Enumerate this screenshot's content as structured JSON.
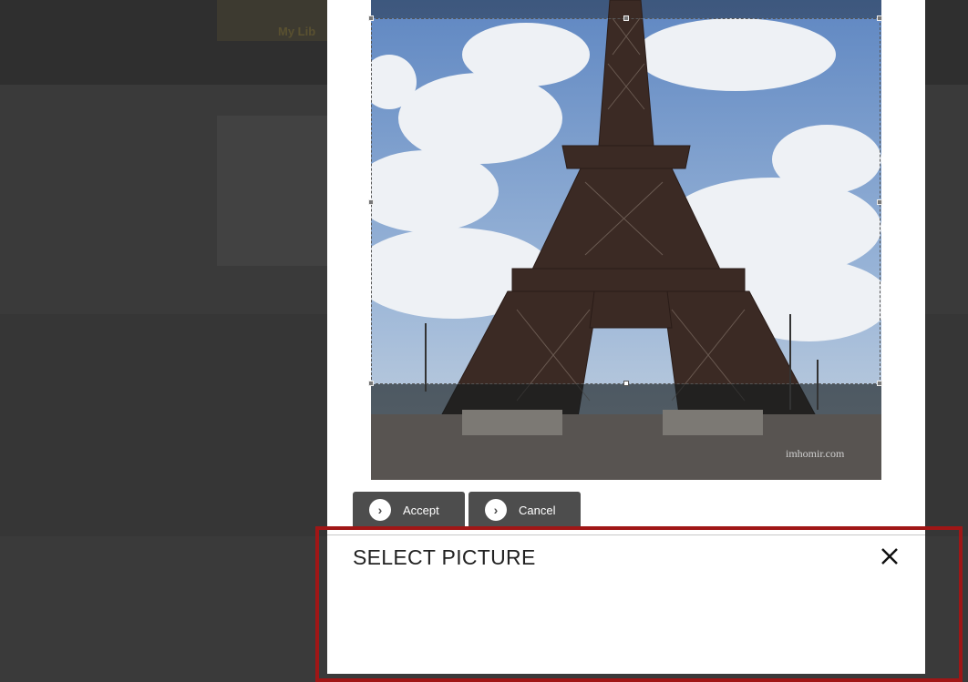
{
  "background": {
    "link_text": "My Lib"
  },
  "editor": {
    "photo_alt": "Eiffel Tower photo",
    "watermark": "imhomir.com"
  },
  "buttons": {
    "accept_label": "Accept",
    "cancel_label": "Cancel"
  },
  "dialog": {
    "title": "SELECT PICTURE"
  },
  "icons": {
    "accept": "chevron-right-icon",
    "cancel": "chevron-right-icon",
    "close": "close-icon"
  },
  "colors": {
    "overlay": "#3a3a3a",
    "button": "#4d4d4d",
    "highlight": "#a01616"
  }
}
